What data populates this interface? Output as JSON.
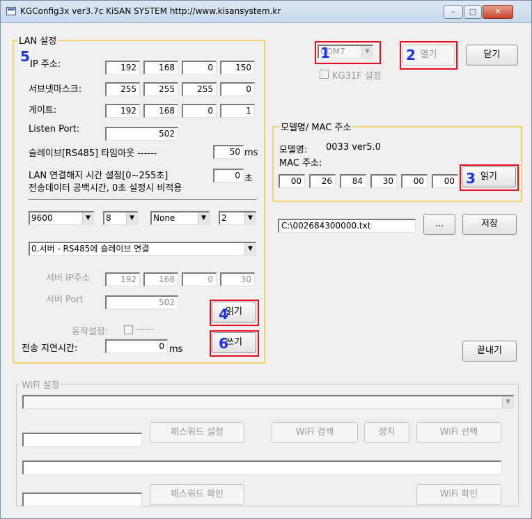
{
  "window": {
    "title": "KGConfig3x  ver3.7c   KiSAN SYSTEM http://www.kisansystem.kr",
    "min_glyph": "–",
    "max_glyph": "□",
    "close_glyph": "✕"
  },
  "lan": {
    "legend": "LAN 설정",
    "ip_label": "IP 주소:",
    "ip": [
      "192",
      "168",
      "0",
      "150"
    ],
    "subnet_label": "서브넷마스크:",
    "subnet": [
      "255",
      "255",
      "255",
      "0"
    ],
    "gateway_label": "게이트:",
    "gateway": [
      "192",
      "168",
      "0",
      "1"
    ],
    "listen_port_label": "Listen Port:",
    "listen_port": "502",
    "slave_timeout_label": "슬레이브[RS485] 타임아웃 ------",
    "slave_timeout": "50",
    "slave_timeout_unit": "ms",
    "disconnect_label": "LAN 연결해지 시간 설정[0~255초]",
    "disconnect_value": "0",
    "disconnect_unit": "초",
    "disconnect_note": "전송데이터 공백시간, 0초 설정시 비적용",
    "baud": "9600",
    "data_bits": "8",
    "parity": "None",
    "stop_bits": "2",
    "mode": "0.서버 - RS485에 슬레이브 연결",
    "server_ip_label": "서버 IP주소",
    "server_ip": [
      "192",
      "168",
      "0",
      "30"
    ],
    "server_port_label": "서버 Port",
    "server_port": "502",
    "action_label": "동작설정:",
    "action_value": "------",
    "read_button": "읽기",
    "delay_label": "전송 지연시간:",
    "delay_value": "0",
    "delay_unit": "ms",
    "write_button": "쓰기"
  },
  "port": {
    "com": "COM7",
    "open_button": "열기",
    "close_button": "닫기",
    "kg31f_label": "KG31F 설정"
  },
  "model": {
    "legend": "모델명/ MAC 주소",
    "model_label": "모델명:",
    "model_value": "0033 ver5.0",
    "mac_label": "MAC 주소:",
    "mac": [
      "00",
      "26",
      "84",
      "30",
      "00",
      "00"
    ],
    "read_button": "읽기"
  },
  "save": {
    "path": "C:\\002684300000.txt",
    "browse_button": "...",
    "save_button": "저장"
  },
  "exit_button": "끝내기",
  "wifi": {
    "legend": "WiFi 설정",
    "ssid_value": "",
    "password_set_button": "패스워드 설정",
    "scan_button": "WiFi 검색",
    "stop_button": "정지",
    "select_button": "WiFi 선택",
    "password_confirm_button": "패스워드 확인",
    "confirm_button": "WiFi 확인"
  },
  "annotations": [
    "1",
    "2",
    "3",
    "4",
    "5",
    "6"
  ],
  "colors": {
    "annotation_number": "#1a33e6",
    "annotation_box": "#e2101d",
    "group_border": "#f4d26a"
  }
}
